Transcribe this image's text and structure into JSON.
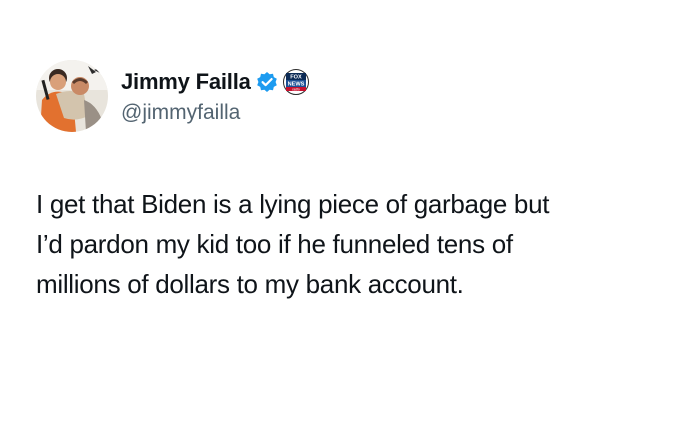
{
  "author": {
    "display_name": "Jimmy Failla",
    "handle": "@jimmyfailla",
    "verified_color": "#1d9bf0",
    "affiliation_badge": {
      "icon": "fox-news-radio-logo",
      "lines": [
        "FOX",
        "NEWS",
        "radio"
      ],
      "color": "#003366"
    }
  },
  "tweet": {
    "text_lines": [
      "I get that Biden is a lying piece of garbage but",
      "I’d pardon my kid too if he funneled tens of",
      "millions of dollars to my bank account."
    ]
  }
}
